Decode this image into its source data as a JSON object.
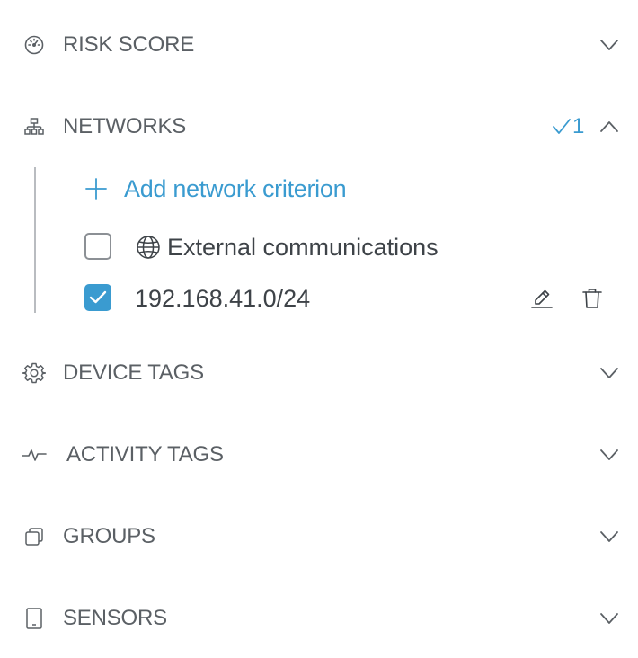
{
  "sections": [
    {
      "id": "risk-score",
      "label": "RISK SCORE",
      "icon": "gauge-icon",
      "expanded": false
    },
    {
      "id": "networks",
      "label": "NETWORKS",
      "icon": "network-icon",
      "expanded": true,
      "selected_count": "1"
    },
    {
      "id": "device-tags",
      "label": "DEVICE TAGS",
      "icon": "gear-icon",
      "expanded": false
    },
    {
      "id": "activity-tags",
      "label": "ACTIVITY TAGS",
      "icon": "activity-pulse-icon",
      "expanded": false
    },
    {
      "id": "groups",
      "label": "GROUPS",
      "icon": "stack-icon",
      "expanded": false
    },
    {
      "id": "sensors",
      "label": "SENSORS",
      "icon": "tablet-icon",
      "expanded": false
    }
  ],
  "networks": {
    "add_label": "Add network criterion",
    "criteria": [
      {
        "label": "External communications",
        "checked": false,
        "icon": "globe-icon"
      },
      {
        "label": "192.168.41.0/24",
        "checked": true
      }
    ]
  },
  "colors": {
    "accent": "#3a9bd0",
    "text": "#5b6065",
    "tree_line": "#b9bcc0"
  }
}
